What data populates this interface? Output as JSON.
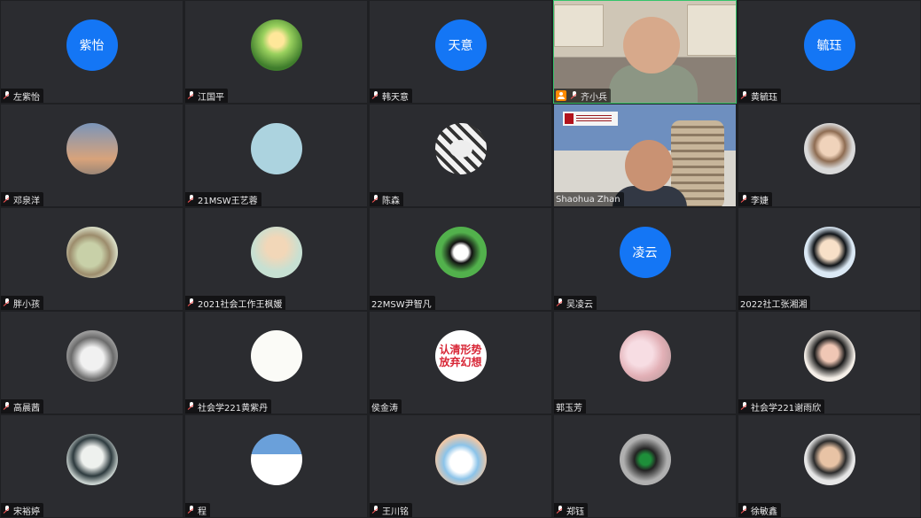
{
  "colors": {
    "avatar_blue": "#1476f5",
    "active_border": "#35c46b",
    "host_badge": "#ff8a00"
  },
  "tiles": [
    {
      "name": "左紫怡",
      "avatar_text": "紫怡"
    },
    {
      "name": "江国平",
      "avatar_icon": "forest-photo-icon"
    },
    {
      "name": "韩天意",
      "avatar_text": "天意"
    },
    {
      "name": "齐小兵",
      "video": true,
      "host": true
    },
    {
      "name": "黄毓珏",
      "avatar_text": "毓珏"
    },
    {
      "name": "邓泉洋",
      "avatar_icon": "sunset-sky-icon"
    },
    {
      "name": "21MSW王艺蓉",
      "avatar_icon": "light-blue-circle-icon"
    },
    {
      "name": "陈森",
      "avatar_icon": "cup-photo-icon"
    },
    {
      "name": "Shaohua Zhan",
      "video": true
    },
    {
      "name": "李婕",
      "avatar_icon": "baby-photo-icon"
    },
    {
      "name": "胖小孩",
      "avatar_icon": "bunny-photo-icon"
    },
    {
      "name": "2021社会工作王枫媛",
      "avatar_icon": "girl-drawing-icon"
    },
    {
      "name": "22MSW尹智凡",
      "avatar_icon": "penguin-photo-icon"
    },
    {
      "name": "吴凌云",
      "avatar_text": "凌云"
    },
    {
      "name": "2022社工张湘湘",
      "avatar_icon": "cartoon-boy-icon"
    },
    {
      "name": "高晨茜",
      "avatar_icon": "cat-photo-icon"
    },
    {
      "name": "社会学221黄紫丹",
      "avatar_icon": "flower-drawing-icon"
    },
    {
      "name": "侯金涛",
      "avatar_text_image": "认清形势\n放弃幻想"
    },
    {
      "name": "郭玉芳",
      "avatar_icon": "blossom-photo-icon"
    },
    {
      "name": "社会学221谢雨欣",
      "avatar_icon": "woman-portrait-icon"
    },
    {
      "name": "宋裕婷",
      "avatar_icon": "anime-character-icon"
    },
    {
      "name": "程",
      "avatar_icon": "child-photo-icon"
    },
    {
      "name": "王川铭",
      "avatar_icon": "bear-toy-icon"
    },
    {
      "name": "郑钰",
      "avatar_icon": "traffic-light-icon"
    },
    {
      "name": "徐敏鑫",
      "avatar_icon": "boy-portrait-icon"
    }
  ]
}
